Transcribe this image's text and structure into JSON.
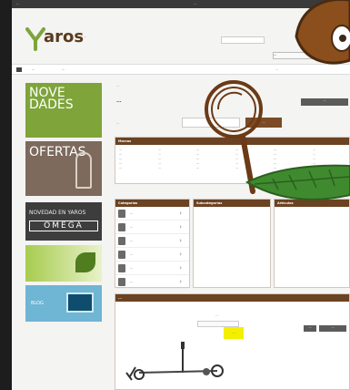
{
  "topbar": {
    "contact": "...",
    "links": "..."
  },
  "header": {
    "logo": "aros",
    "tagline": "...",
    "search_button": "",
    "account_button": "...",
    "cart_button": "..."
  },
  "nav": {
    "item1": "...",
    "item2": "...",
    "right": "..."
  },
  "banners": {
    "b1": {
      "line1": "NOVE",
      "line2": "DADES"
    },
    "b2": {
      "title": "OFERTAS"
    },
    "b3": {
      "subtitle": "NOVEDAD EN YAROS",
      "brand": "OMEGA"
    },
    "b5": {
      "text": "BLOG"
    }
  },
  "content": {
    "breadcrumb": "...",
    "title": "...",
    "pager": "...",
    "filter_label": "...",
    "filter_button": "..."
  },
  "panels": {
    "brands_title": "Marcas",
    "brands": [
      "...",
      "...",
      "...",
      "...",
      "...",
      "...",
      "...",
      "...",
      "...",
      "...",
      "...",
      "...",
      "...",
      "...",
      "...",
      "...",
      "...",
      "...",
      "...",
      "...",
      "...",
      "...",
      "...",
      "...",
      "...",
      "...",
      "...",
      "...",
      "...",
      "..."
    ],
    "categories_title": "Categorías",
    "subcategories_title": "Subcategorías",
    "articles_title": "Artículos",
    "categories": [
      "...",
      "...",
      "...",
      "...",
      "...",
      "..."
    ]
  },
  "results": {
    "title": "...",
    "sort_label": "...",
    "sort_value": "",
    "view_list": "...",
    "view_grid": "...",
    "highlight": "..."
  },
  "icons": {
    "logo": "yaros-logo-icon",
    "home": "home-icon",
    "magnifier": "magnifier-doodle-icon",
    "bird": "bird-doodle-icon",
    "feather": "green-feather-doodle-icon"
  },
  "colors": {
    "brand_brown": "#6b4222",
    "accent_orange": "#c8702a",
    "green": "#7ea43a",
    "highlight": "#f4ee00"
  }
}
